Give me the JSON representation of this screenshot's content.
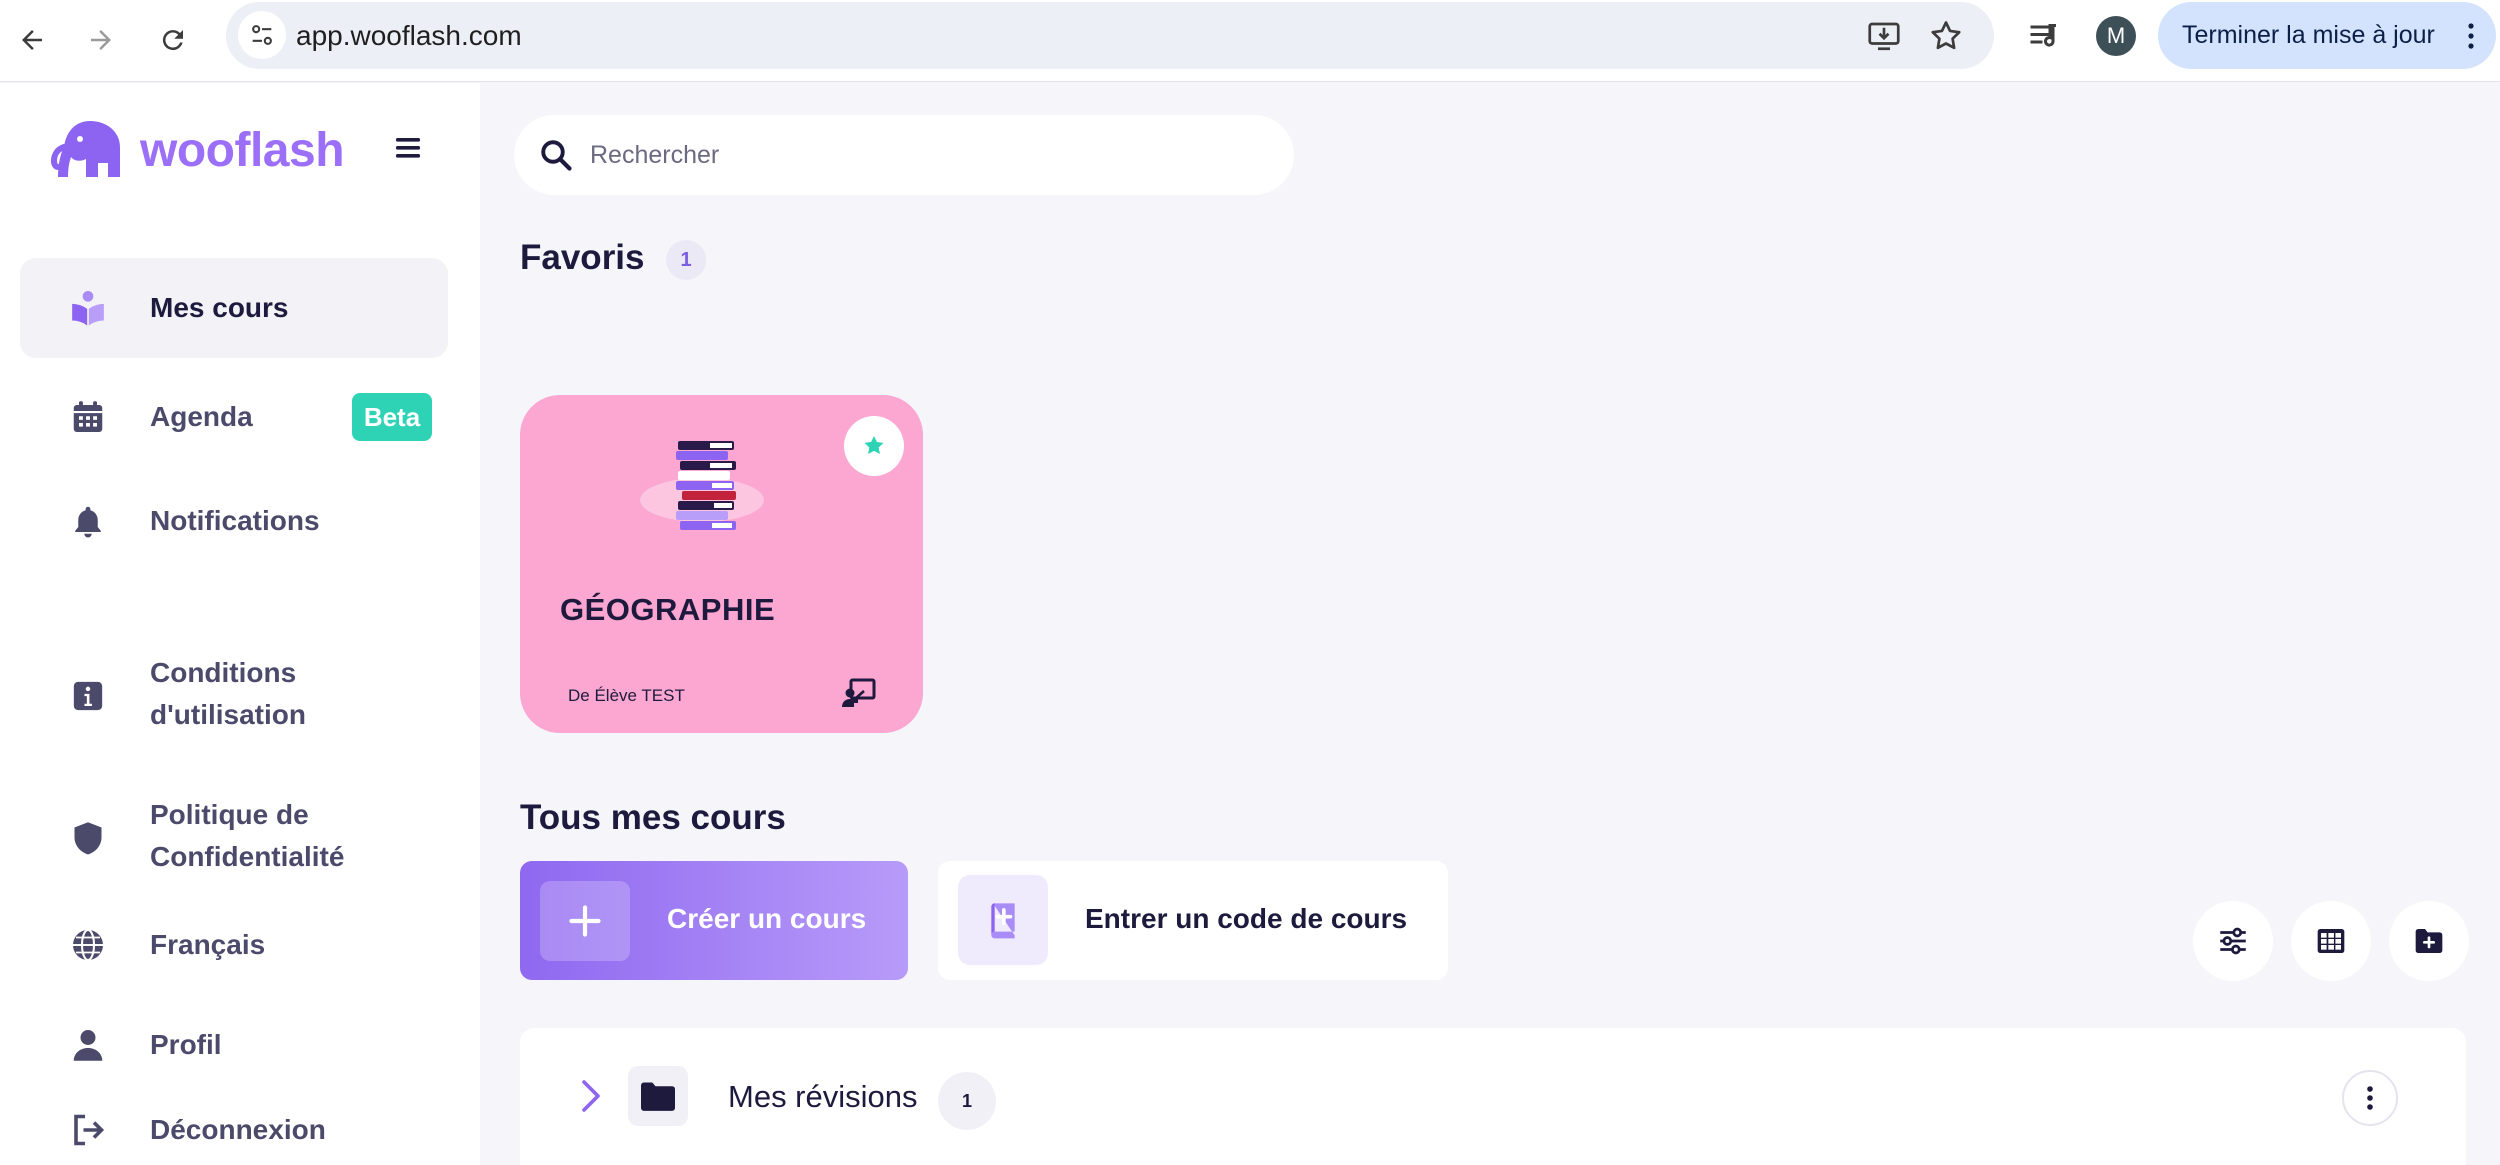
{
  "browser": {
    "url": "app.wooflash.com",
    "avatar_letter": "M",
    "update_label": "Terminer la mise à jour",
    "icons": [
      "back-arrow-icon",
      "forward-arrow-icon",
      "reload-icon",
      "site-info-icon",
      "install-app-icon",
      "bookmark-star-icon",
      "media-queue-icon",
      "more-vert-icon"
    ]
  },
  "sidebar": {
    "brand": "wooflash",
    "items": [
      {
        "label": "Mes cours",
        "icon": "book-reader-icon",
        "active": true
      },
      {
        "label": "Agenda",
        "icon": "calendar-icon",
        "badge": "Beta"
      },
      {
        "label": "Notifications",
        "icon": "bell-icon"
      },
      {
        "label": "Conditions d'utilisation",
        "line1": "Conditions",
        "line2": "d'utilisation",
        "icon": "info-icon"
      },
      {
        "label": "Politique de Confidentialité",
        "line1": "Politique de",
        "line2": "Confidentialité",
        "icon": "shield-icon"
      },
      {
        "label": "Français",
        "icon": "globe-icon"
      },
      {
        "label": "Profil",
        "icon": "user-icon"
      },
      {
        "label": "Déconnexion",
        "icon": "logout-icon"
      }
    ]
  },
  "search": {
    "placeholder": "Rechercher"
  },
  "favorites": {
    "title": "Favoris",
    "count": "1",
    "courses": [
      {
        "title": "GÉOGRAPHIE",
        "author": "De Élève TEST",
        "color": "#fba7d1"
      }
    ]
  },
  "all_courses": {
    "title": "Tous mes cours",
    "create_label": "Créer un cours",
    "code_label": "Entrer un code de cours",
    "tools": [
      "filter-sliders-icon",
      "grid-view-icon",
      "new-folder-icon"
    ],
    "folders": [
      {
        "label": "Mes révisions",
        "count": "1"
      }
    ]
  },
  "colors": {
    "accent": "#9b6ff7",
    "beta": "#2ed3b6",
    "background": "#f5f5fa",
    "card_pink": "#fba7d1"
  }
}
